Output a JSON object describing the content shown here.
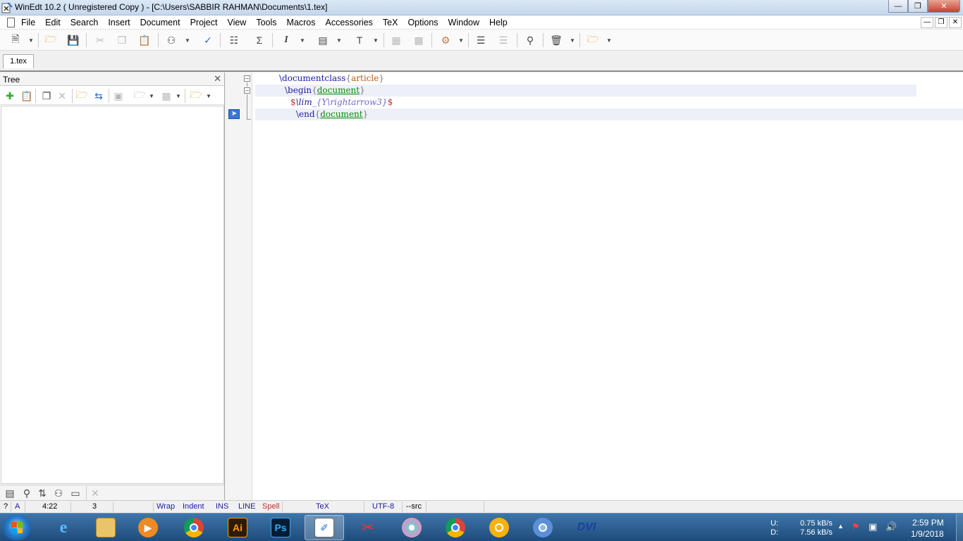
{
  "window": {
    "title": "WinEdt 10.2  ( Unregistered  Copy )  - [C:\\Users\\SABBIR RAHMAN\\Documents\\1.tex]"
  },
  "menu": [
    "File",
    "Edit",
    "Search",
    "Insert",
    "Document",
    "Project",
    "View",
    "Tools",
    "Macros",
    "Accessories",
    "TeX",
    "Options",
    "Window",
    "Help"
  ],
  "tabs": [
    {
      "label": "1.tex",
      "active": true
    }
  ],
  "tree_panel": {
    "title": "Tree"
  },
  "editor": {
    "lines": [
      {
        "cmd": "\\documentclass",
        "arg": "article"
      },
      {
        "cmd": "\\begin",
        "arg": "document"
      },
      {
        "math_open": "$",
        "math_body_cmd": "\\lim",
        "math_sub": "_{Y\\rightarrow3}",
        "math_close": "$"
      },
      {
        "cmd": "\\end",
        "arg": "document"
      }
    ]
  },
  "statusbar": {
    "help": "?",
    "mode": "A",
    "position": "4:22",
    "lines": "3",
    "wrap": "Wrap",
    "indent": "Indent",
    "ins": "INS",
    "line": "LINE",
    "spell": "Spell",
    "tex": "TeX",
    "encoding": "UTF-8",
    "src": "--src"
  },
  "taskbar": {
    "net_upload_label": "U:",
    "net_upload": "0.75 kB/s",
    "net_download_label": "D:",
    "net_download": "7.56 kB/s",
    "time": "2:59 PM",
    "date": "1/9/2018",
    "apps": [
      "internet-explorer",
      "file-explorer",
      "media-player",
      "chrome",
      "illustrator",
      "photoshop",
      "winedt",
      "snipping-tool",
      "paint",
      "chrome-beta",
      "chrome-canary",
      "chromium",
      "yap-dvi-viewer"
    ]
  },
  "colors": {
    "command": "#1a1aa6",
    "env_arg": "#0a8a0a",
    "class_arg": "#b2601f",
    "spell_status": "#c03030",
    "taskbar": "#1d4c7c"
  }
}
